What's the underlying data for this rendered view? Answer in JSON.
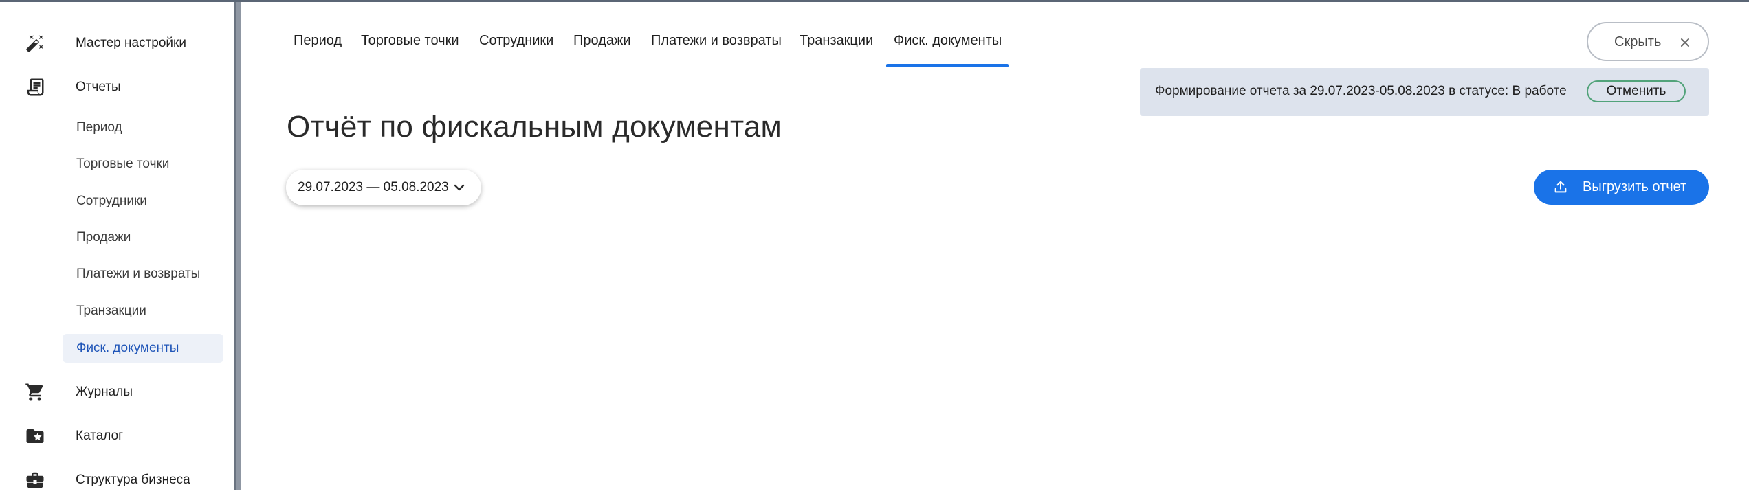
{
  "sidebar": {
    "items": [
      {
        "label": "Мастер настройки",
        "icon": "magic-wand-icon"
      },
      {
        "label": "Отчеты",
        "icon": "report-icon"
      },
      {
        "label": "Журналы",
        "icon": "cart-icon"
      },
      {
        "label": "Каталог",
        "icon": "folder-star-icon"
      },
      {
        "label": "Структура бизнеса",
        "icon": "briefcase-icon"
      }
    ],
    "reports_sub": [
      {
        "label": "Период"
      },
      {
        "label": "Торговые точки"
      },
      {
        "label": "Сотрудники"
      },
      {
        "label": "Продажи"
      },
      {
        "label": "Платежи и возвраты"
      },
      {
        "label": "Транзакции"
      },
      {
        "label": "Фиск. документы",
        "active": true
      }
    ]
  },
  "tabs": [
    {
      "label": "Период"
    },
    {
      "label": "Торговые точки"
    },
    {
      "label": "Сотрудники"
    },
    {
      "label": "Продажи"
    },
    {
      "label": "Платежи и возвраты"
    },
    {
      "label": "Транзакции"
    },
    {
      "label": "Фиск. документы",
      "active": true
    }
  ],
  "page": {
    "title": "Отчёт по фискальным документам",
    "date_range": "29.07.2023 — 05.08.2023"
  },
  "notice": {
    "text": "Формирование отчета за 29.07.2023-05.08.2023 в статусе: В работе",
    "cancel_label": "Отменить"
  },
  "hide_label": "Скрыть",
  "export_label": "Выгрузить отчет",
  "colors": {
    "accent": "#1a73e8",
    "notice_bg": "#dde3ed",
    "active_sub_bg": "#edf1f8",
    "active_sub_text": "#1f55b8",
    "cancel_border": "#52a37a"
  }
}
